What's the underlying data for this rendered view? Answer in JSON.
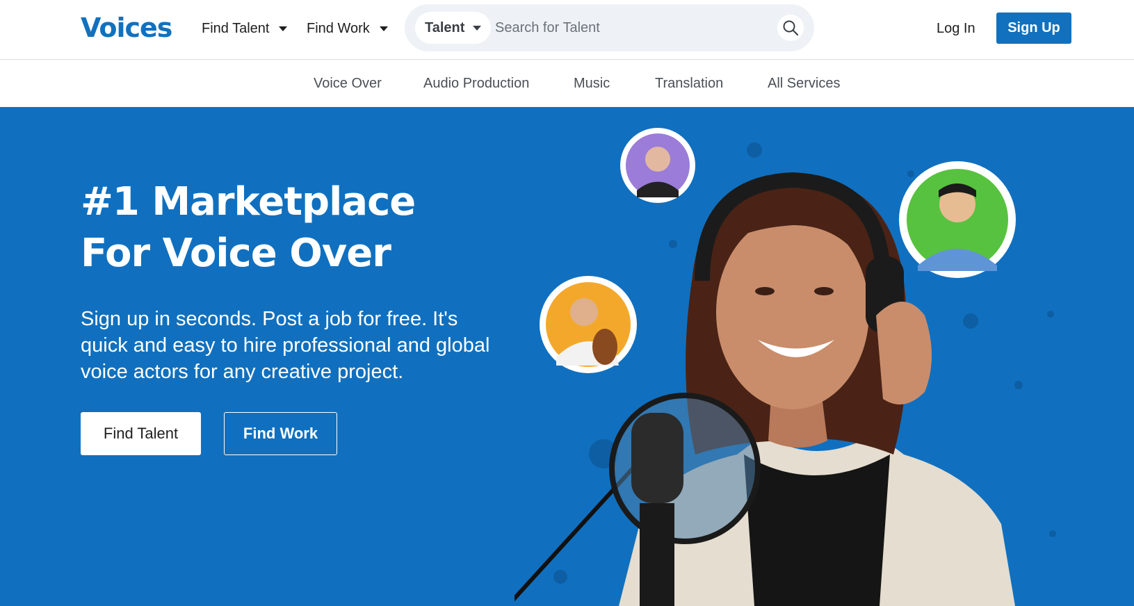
{
  "header": {
    "logo": "Voices",
    "nav": [
      {
        "label": "Find Talent"
      },
      {
        "label": "Find Work"
      }
    ],
    "search": {
      "type_label": "Talent",
      "placeholder": "Search for Talent",
      "value": ""
    },
    "login_label": "Log In",
    "signup_label": "Sign Up"
  },
  "subnav": {
    "items": [
      {
        "label": "Voice Over"
      },
      {
        "label": "Audio Production"
      },
      {
        "label": "Music"
      },
      {
        "label": "Translation"
      },
      {
        "label": "All Services"
      }
    ]
  },
  "hero": {
    "title_line1": "#1 Marketplace",
    "title_line2": "For Voice Over",
    "subtitle": "Sign up in seconds. Post a job for free. It's quick and easy to hire professional and global voice actors for any creative project.",
    "cta_talent": "Find Talent",
    "cta_work": "Find Work"
  },
  "colors": {
    "brand_blue": "#1171be",
    "hero_blue": "#1070bf",
    "text_dark": "#1e1e1e",
    "search_bg": "#eef2f6"
  },
  "icons": {
    "search": "search-icon",
    "dropdown": "caret-down-icon"
  }
}
